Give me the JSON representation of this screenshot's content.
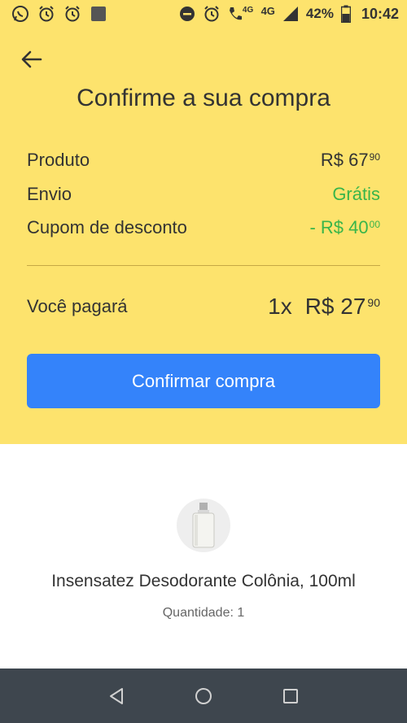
{
  "status_bar": {
    "time": "10:42",
    "battery": "42%",
    "network_small": "4G",
    "network": "4G",
    "icons": [
      "whatsapp-icon",
      "alarm-icon",
      "alarm-icon",
      "app-icon",
      "do-not-disturb-icon",
      "alarm-icon",
      "call-icon",
      "signal-icon",
      "battery-icon"
    ]
  },
  "header": {
    "title": "Confirme a sua compra"
  },
  "summary": {
    "product_label": "Produto",
    "product_value_main": "R$ 67",
    "product_value_cents": "90",
    "shipping_label": "Envio",
    "shipping_value": "Grátis",
    "coupon_label": "Cupom de desconto",
    "coupon_value_main": "- R$ 40",
    "coupon_value_cents": "00",
    "total_label": "Você pagará",
    "total_qty": "1x",
    "total_value_main": "R$ 27",
    "total_value_cents": "90"
  },
  "confirm_button": "Confirmar compra",
  "product": {
    "name": "Insensatez Desodorante Colônia, 100ml",
    "quantity": "Quantidade: 1"
  },
  "colors": {
    "header_bg": "#fde36d",
    "accent_blue": "#3483fa",
    "green": "#39b54a",
    "nav_bg": "#3e464e"
  }
}
